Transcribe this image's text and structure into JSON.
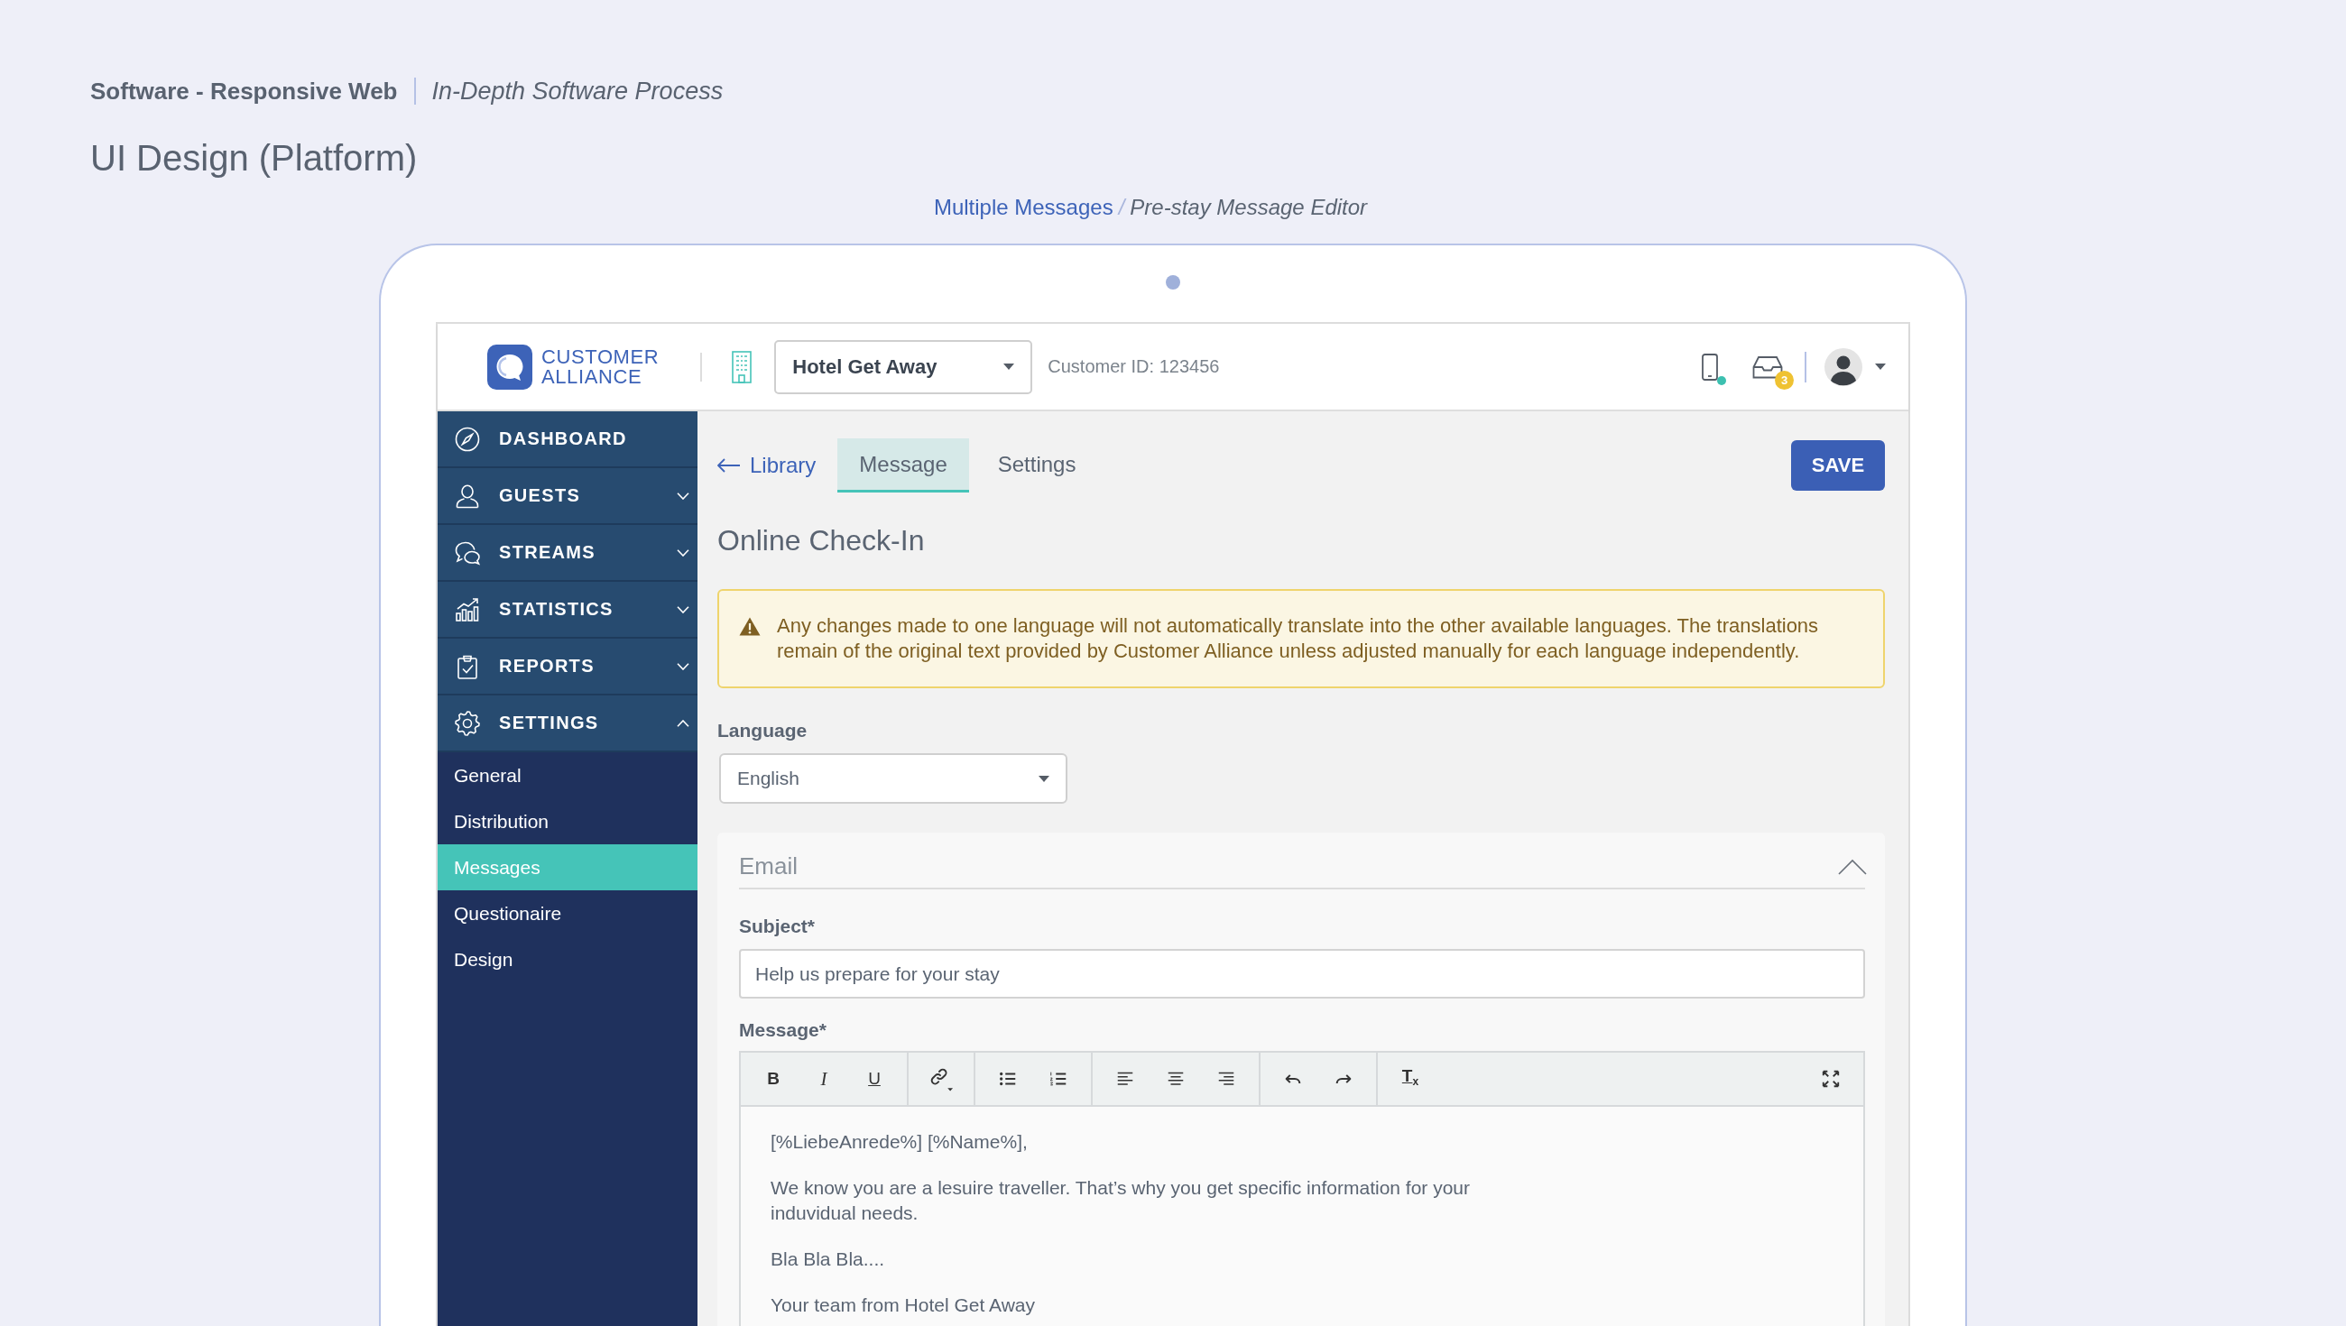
{
  "header": {
    "project": "Software - Responsive Web",
    "process": "In-Depth Software Process",
    "title": "UI Design (Platform)"
  },
  "breadcrumb": {
    "parent": "Multiple Messages",
    "separator": "/",
    "current": "Pre-stay Message Editor"
  },
  "app": {
    "topbar": {
      "logo": {
        "line_1": "CUSTOMER",
        "line_2": "ALLIANCE"
      },
      "property": {
        "value": "Hotel Get Away"
      },
      "customer_id": "Customer ID: 123456",
      "inbox_badge": "3"
    },
    "sidebar": {
      "items": [
        {
          "label": "DASHBOARD"
        },
        {
          "label": "GUESTS",
          "expanded": false
        },
        {
          "label": "STREAMS",
          "expanded": false
        },
        {
          "label": "STATISTICS",
          "expanded": false
        },
        {
          "label": "REPORTS",
          "expanded": false
        },
        {
          "label": "SETTINGS",
          "expanded": true,
          "children": [
            {
              "label": "General",
              "selected": false
            },
            {
              "label": "Distribution",
              "selected": false
            },
            {
              "label": "Messages",
              "selected": true
            },
            {
              "label": "Questionaire",
              "selected": false
            },
            {
              "label": "Design",
              "selected": false
            }
          ]
        }
      ]
    },
    "editor_page": {
      "back_link": "Library",
      "tabs": [
        {
          "label": "Message",
          "selected": true
        },
        {
          "label": "Settings",
          "selected": false
        }
      ],
      "save_button": "SAVE",
      "title": "Online Check-In",
      "warning": "Any changes made to one language will not automatically translate into the other available languages. The translations remain of the original text provided by Customer Alliance unless adjusted manually for each language independently.",
      "language": {
        "label": "Language",
        "value": "English"
      },
      "email": {
        "title": "Email",
        "expanded": true,
        "subject": {
          "label": "Subject*",
          "value": "Help us prepare for your stay"
        },
        "message": {
          "label": "Message*",
          "toolbar": [
            {
              "tools": [
                {
                  "kind": "bold",
                  "glyph": "B"
                },
                {
                  "kind": "italic",
                  "glyph": "I"
                },
                {
                  "kind": "underline",
                  "glyph": "U"
                }
              ]
            },
            {
              "tools": [
                {
                  "kind": "link"
                }
              ]
            },
            {
              "tools": [
                {
                  "kind": "bullet_list"
                },
                {
                  "kind": "numbered_list"
                }
              ]
            },
            {
              "tools": [
                {
                  "kind": "align_left"
                },
                {
                  "kind": "align_center"
                },
                {
                  "kind": "align_right"
                }
              ]
            },
            {
              "tools": [
                {
                  "kind": "undo"
                },
                {
                  "kind": "redo"
                }
              ]
            },
            {
              "tools": [
                {
                  "kind": "clear_format",
                  "glyph": "T$_{x}$"
                }
              ]
            },
            {
              "tools": [
                {
                  "kind": "fullscreen"
                }
              ]
            }
          ],
          "body": [
            "[%LiebeAnrede%] [%Name%],",
            "We know you are a lesuire traveller. That’s why you get specific information for your\ninduvidual needs.",
            "Bla Bla Bla....",
            "Your team from Hotel Get Away"
          ]
        }
      }
    }
  }
}
